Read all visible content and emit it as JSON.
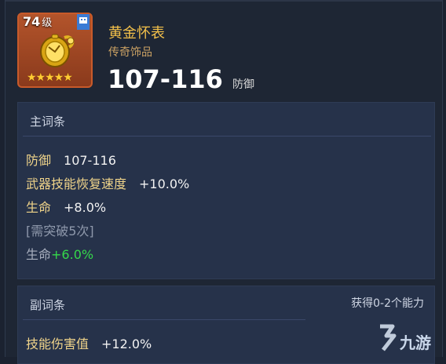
{
  "item": {
    "level": "74",
    "level_suffix": "级",
    "name": "黄金怀表",
    "rarity": "传奇饰品",
    "stat_value": "107-116",
    "stat_label": "防御",
    "stars": 5,
    "stars_text": "★★★★★"
  },
  "main_section": {
    "title": "主词条",
    "stats": [
      {
        "key": "防御",
        "value": "107-116"
      },
      {
        "key": "武器技能恢复速度",
        "value": "+10.0%"
      },
      {
        "key": "生命",
        "value": "+8.0%"
      }
    ],
    "locked_note": "[需突破5次]",
    "locked_stat": {
      "key": "生命",
      "value": "+6.0%"
    }
  },
  "sub_section": {
    "title": "副词条",
    "right_note": "获得0-2个能力",
    "stats": [
      {
        "key": "技能伤害值",
        "value": "+12.0%"
      }
    ]
  },
  "watermark": {
    "text": "九游"
  },
  "colors": {
    "frame": "#c85a2a",
    "name": "#f3c04a",
    "bonus_green": "#35d84a"
  }
}
